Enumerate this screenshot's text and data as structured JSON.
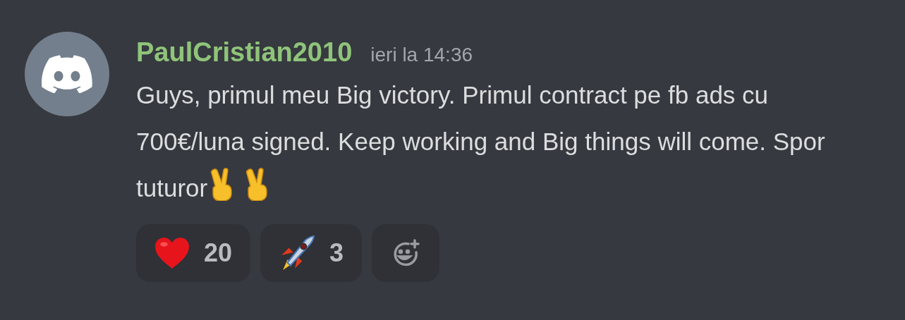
{
  "message": {
    "author": "PaulCristian2010",
    "timestamp": "ieri la 14:36",
    "text": "Guys, primul meu Big victory. Primul contract pe fb ads cu 700€/luna signed. Keep working and Big things will come. Spor tuturor",
    "trailing_emoji": [
      {
        "kind": "victory"
      },
      {
        "kind": "victory"
      }
    ]
  },
  "reactions": [
    {
      "kind": "heart",
      "count": "20"
    },
    {
      "kind": "rocket",
      "count": "3"
    }
  ],
  "add_reaction": {
    "kind": "add"
  }
}
